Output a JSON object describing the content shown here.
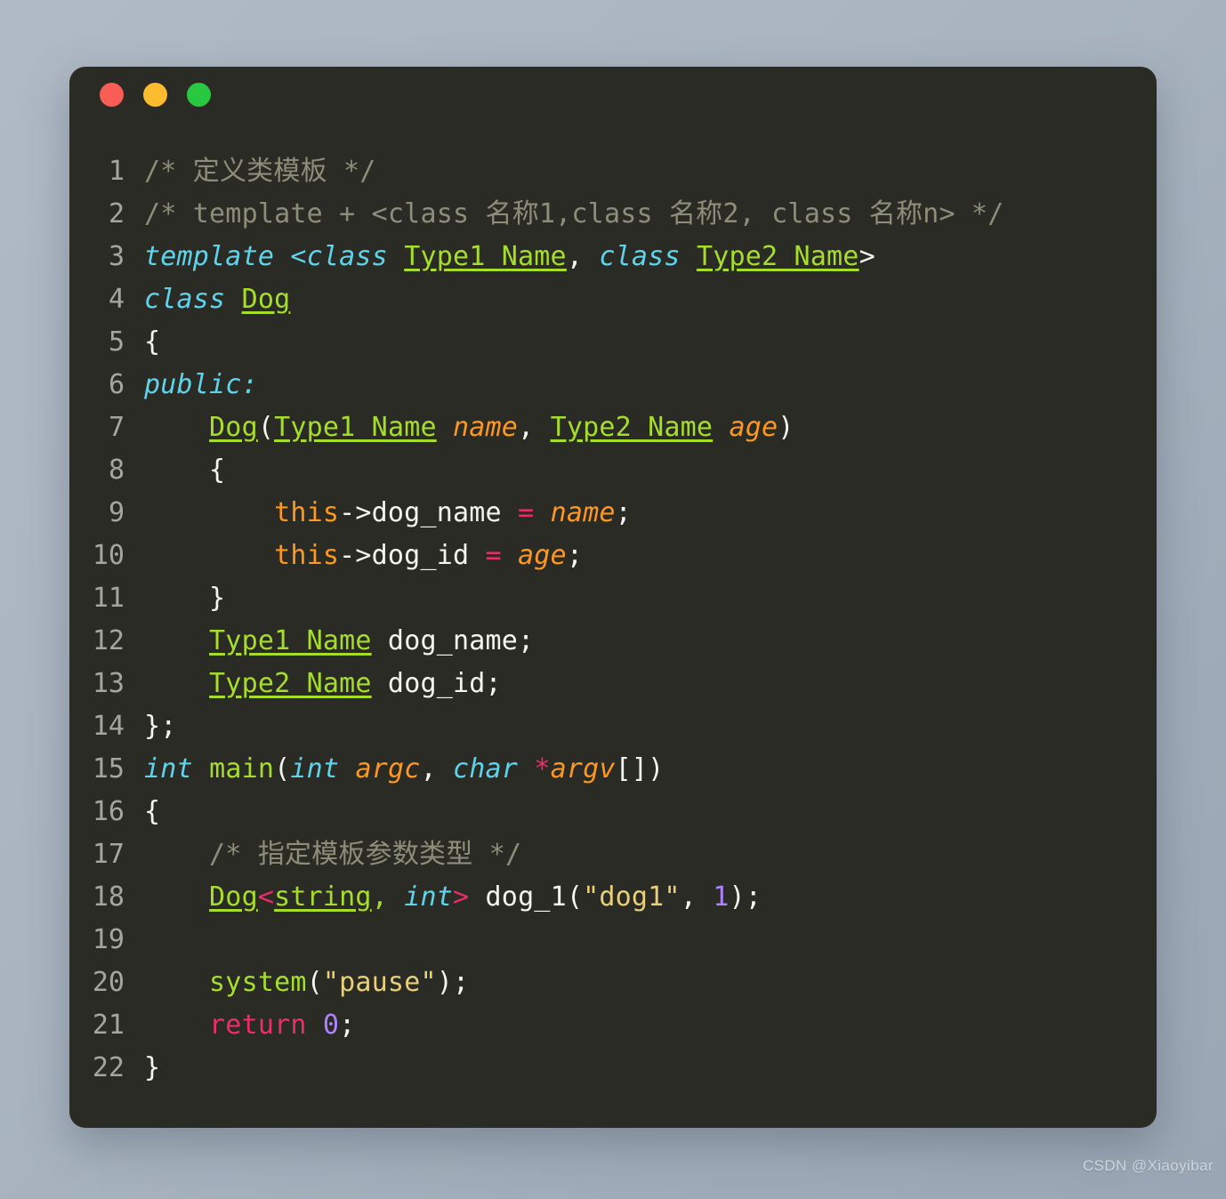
{
  "window": {
    "traffic_lights": [
      {
        "name": "close",
        "color": "#fa5d55"
      },
      {
        "name": "minimize",
        "color": "#fdbb2e"
      },
      {
        "name": "maximize",
        "color": "#28c840"
      }
    ]
  },
  "theme": {
    "background": "#a9b4c0",
    "editor_background": "#2b2b25",
    "linenumber": "#a6a69c",
    "plain": "#f4f4f0",
    "comment": "#8e8d7a",
    "keyword": "#5ed4ec",
    "type": "#a6dd2a",
    "function": "#a6dd2a",
    "parameter": "#fd9720",
    "operator": "#ec2c6b",
    "string": "#e8d07a",
    "number": "#ae81ff"
  },
  "watermark": "CSDN @Xiaoyibar",
  "code": {
    "language": "cpp",
    "line_numbers": [
      "1",
      "2",
      "3",
      "4",
      "5",
      "6",
      "7",
      "8",
      "9",
      "10",
      "11",
      "12",
      "13",
      "14",
      "15",
      "16",
      "17",
      "18",
      "19",
      "20",
      "21",
      "22"
    ],
    "lines": [
      {
        "n": "1",
        "text": "/* 定义类模板 */"
      },
      {
        "n": "2",
        "text": "/* template + <class 名称1,class 名称2, class 名称n> */"
      },
      {
        "n": "3",
        "text": "template <class Type1_Name, class Type2_Name>"
      },
      {
        "n": "4",
        "text": "class Dog"
      },
      {
        "n": "5",
        "text": "{"
      },
      {
        "n": "6",
        "text": "public:"
      },
      {
        "n": "7",
        "text": "    Dog(Type1_Name name, Type2_Name age)"
      },
      {
        "n": "8",
        "text": "    {"
      },
      {
        "n": "9",
        "text": "        this->dog_name = name;"
      },
      {
        "n": "10",
        "text": "        this->dog_id = age;"
      },
      {
        "n": "11",
        "text": "    }"
      },
      {
        "n": "12",
        "text": "    Type1_Name dog_name;"
      },
      {
        "n": "13",
        "text": "    Type2_Name dog_id;"
      },
      {
        "n": "14",
        "text": "};"
      },
      {
        "n": "15",
        "text": "int main(int argc, char *argv[])"
      },
      {
        "n": "16",
        "text": "{"
      },
      {
        "n": "17",
        "text": "    /* 指定模板参数类型 */"
      },
      {
        "n": "18",
        "text": "    Dog<string, int> dog_1(\"dog1\", 1);"
      },
      {
        "n": "19",
        "text": ""
      },
      {
        "n": "20",
        "text": "    system(\"pause\");"
      },
      {
        "n": "21",
        "text": "    return 0;"
      },
      {
        "n": "22",
        "text": "}"
      }
    ],
    "tokens": [
      [
        {
          "c": "comment",
          "t": "/* 定义类模板 */"
        }
      ],
      [
        {
          "c": "comment",
          "t": "/* template + <class 名称1,class 名称2, class 名称n> */"
        }
      ],
      [
        {
          "c": "kw",
          "t": "template"
        },
        {
          "c": "plain",
          "t": " "
        },
        {
          "c": "kw",
          "t": "<class"
        },
        {
          "c": "plain",
          "t": " "
        },
        {
          "c": "type",
          "t": "Type1_Name"
        },
        {
          "c": "plain",
          "t": ", "
        },
        {
          "c": "kw",
          "t": "class"
        },
        {
          "c": "plain",
          "t": " "
        },
        {
          "c": "type",
          "t": "Type2_Name"
        },
        {
          "c": "plain",
          "t": ">"
        }
      ],
      [
        {
          "c": "kw",
          "t": "class"
        },
        {
          "c": "plain",
          "t": " "
        },
        {
          "c": "type",
          "t": "Dog"
        }
      ],
      [
        {
          "c": "plain",
          "t": "{"
        }
      ],
      [
        {
          "c": "kw",
          "t": "public:"
        }
      ],
      [
        {
          "c": "plain",
          "t": "    "
        },
        {
          "c": "type",
          "t": "Dog"
        },
        {
          "c": "plain",
          "t": "("
        },
        {
          "c": "type",
          "t": "Type1_Name"
        },
        {
          "c": "plain",
          "t": " "
        },
        {
          "c": "var",
          "t": "name"
        },
        {
          "c": "plain",
          "t": ", "
        },
        {
          "c": "type",
          "t": "Type2_Name"
        },
        {
          "c": "plain",
          "t": " "
        },
        {
          "c": "var",
          "t": "age"
        },
        {
          "c": "plain",
          "t": ")"
        }
      ],
      [
        {
          "c": "plain",
          "t": "    {"
        }
      ],
      [
        {
          "c": "plain",
          "t": "        "
        },
        {
          "c": "this",
          "t": "this"
        },
        {
          "c": "plain",
          "t": "->dog_name "
        },
        {
          "c": "op",
          "t": "="
        },
        {
          "c": "plain",
          "t": " "
        },
        {
          "c": "var",
          "t": "name"
        },
        {
          "c": "plain",
          "t": ";"
        }
      ],
      [
        {
          "c": "plain",
          "t": "        "
        },
        {
          "c": "this",
          "t": "this"
        },
        {
          "c": "plain",
          "t": "->dog_id "
        },
        {
          "c": "op",
          "t": "="
        },
        {
          "c": "plain",
          "t": " "
        },
        {
          "c": "var",
          "t": "age"
        },
        {
          "c": "plain",
          "t": ";"
        }
      ],
      [
        {
          "c": "plain",
          "t": "    }"
        }
      ],
      [
        {
          "c": "plain",
          "t": "    "
        },
        {
          "c": "type",
          "t": "Type1_Name"
        },
        {
          "c": "plain",
          "t": " dog_name;"
        }
      ],
      [
        {
          "c": "plain",
          "t": "    "
        },
        {
          "c": "type",
          "t": "Type2_Name"
        },
        {
          "c": "plain",
          "t": " dog_id;"
        }
      ],
      [
        {
          "c": "plain",
          "t": "};"
        }
      ],
      [
        {
          "c": "kw",
          "t": "int"
        },
        {
          "c": "plain",
          "t": " "
        },
        {
          "c": "fn",
          "t": "main"
        },
        {
          "c": "plain",
          "t": "("
        },
        {
          "c": "kw",
          "t": "int"
        },
        {
          "c": "plain",
          "t": " "
        },
        {
          "c": "var",
          "t": "argc"
        },
        {
          "c": "plain",
          "t": ", "
        },
        {
          "c": "kw",
          "t": "char"
        },
        {
          "c": "plain",
          "t": " "
        },
        {
          "c": "op",
          "t": "*"
        },
        {
          "c": "var",
          "t": "argv"
        },
        {
          "c": "plain",
          "t": "[])"
        }
      ],
      [
        {
          "c": "plain",
          "t": "{"
        }
      ],
      [
        {
          "c": "plain",
          "t": "    "
        },
        {
          "c": "comment",
          "t": "/* 指定模板参数类型 */"
        }
      ],
      [
        {
          "c": "plain",
          "t": "    "
        },
        {
          "c": "type",
          "t": "Dog"
        },
        {
          "c": "op",
          "t": "<"
        },
        {
          "c": "type",
          "t": "string"
        },
        {
          "c": "green",
          "t": ","
        },
        {
          "c": "plain",
          "t": " "
        },
        {
          "c": "kw",
          "t": "int"
        },
        {
          "c": "op",
          "t": ">"
        },
        {
          "c": "plain",
          "t": " dog_1("
        },
        {
          "c": "str",
          "t": "\"dog1\""
        },
        {
          "c": "plain",
          "t": ", "
        },
        {
          "c": "num",
          "t": "1"
        },
        {
          "c": "plain",
          "t": ");"
        }
      ],
      [
        {
          "c": "plain",
          "t": ""
        }
      ],
      [
        {
          "c": "plain",
          "t": "    "
        },
        {
          "c": "fn",
          "t": "system"
        },
        {
          "c": "plain",
          "t": "("
        },
        {
          "c": "str",
          "t": "\"pause\""
        },
        {
          "c": "plain",
          "t": ");"
        }
      ],
      [
        {
          "c": "plain",
          "t": "    "
        },
        {
          "c": "kw2",
          "t": "return"
        },
        {
          "c": "plain",
          "t": " "
        },
        {
          "c": "num",
          "t": "0"
        },
        {
          "c": "plain",
          "t": ";"
        }
      ],
      [
        {
          "c": "plain",
          "t": "}"
        }
      ]
    ]
  }
}
